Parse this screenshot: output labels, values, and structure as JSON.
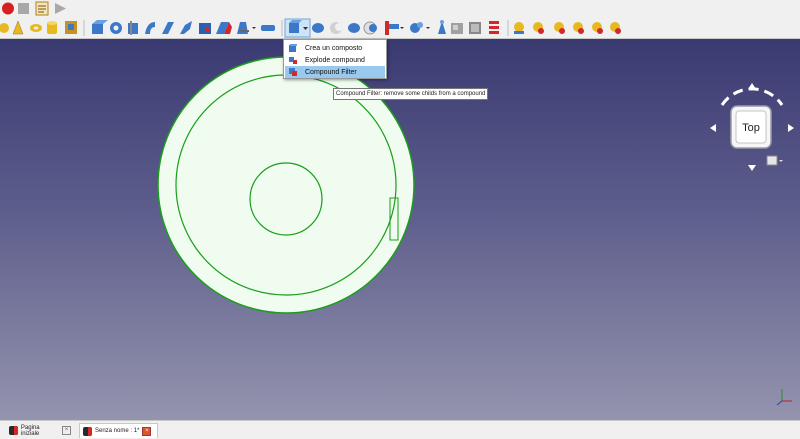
{
  "app": {
    "name": "FreeCAD"
  },
  "toolbar_top": {
    "items": [
      {
        "name": "record-macro-icon",
        "color": "#d42020"
      },
      {
        "name": "stop-macro-icon",
        "color": "#a8a8a8"
      },
      {
        "name": "macro-editor-icon",
        "color": "#d0a020"
      },
      {
        "name": "run-macro-icon",
        "color": "#a8a8a8"
      }
    ]
  },
  "toolbar_part": {
    "compound_button": {
      "icon": "compound-icon"
    },
    "colors": {
      "accent": "#3c78c8",
      "warning": "#e0a020"
    }
  },
  "compound_menu": {
    "items": [
      {
        "label": "Crea un composto",
        "icon": "make-compound-icon",
        "highlighted": false
      },
      {
        "label": "Explode compound",
        "icon": "explode-compound-icon",
        "highlighted": false
      },
      {
        "label": "Compound Filter",
        "icon": "compound-filter-icon",
        "highlighted": true
      }
    ]
  },
  "tooltip": {
    "text": "Compound Filter: remove some childs from a compound"
  },
  "navcube": {
    "face_label": "Top"
  },
  "viewport": {
    "background_top": "#3a3a72",
    "background_bottom": "#9494ae",
    "shape_fill": "#effcef",
    "shape_edge": "#1a9e1a"
  },
  "tabs": [
    {
      "label": "Pagina iniziale",
      "active": false
    },
    {
      "label": "Senza nome : 1*",
      "active": true
    }
  ]
}
